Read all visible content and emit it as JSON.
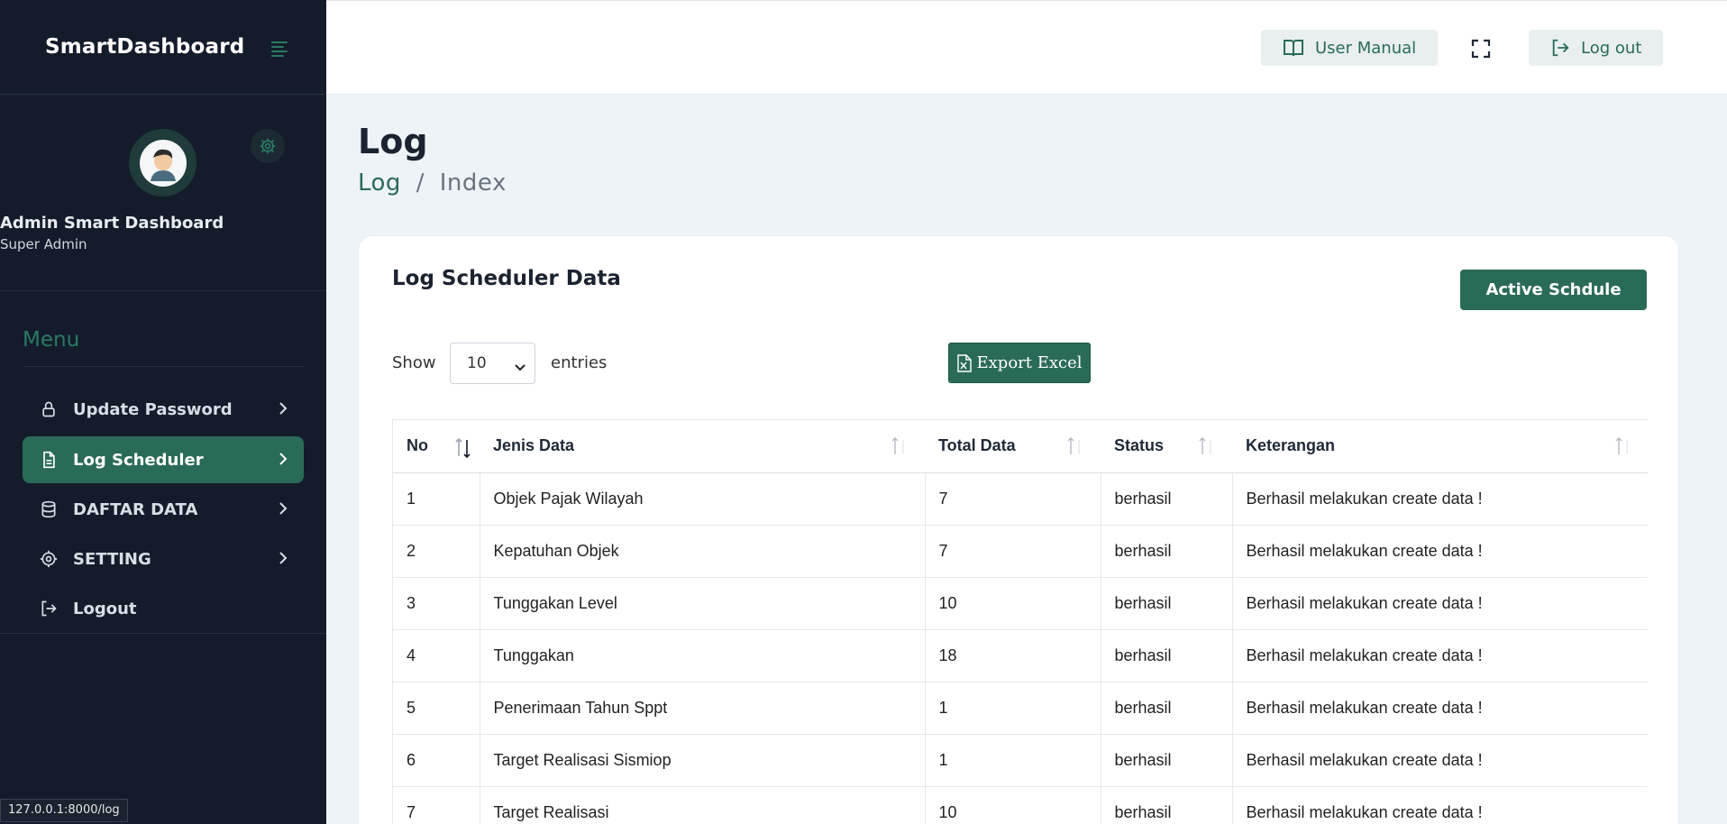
{
  "app": {
    "brand": "SmartDashboard"
  },
  "sidebar": {
    "user_name": "Admin Smart Dashboard",
    "user_role": "Super Admin",
    "menu_title": "Menu",
    "items": [
      {
        "label": "Update Password",
        "icon": "lock-icon",
        "active": false
      },
      {
        "label": "Log Scheduler",
        "icon": "document-icon",
        "active": true
      },
      {
        "label": "DAFTAR DATA",
        "icon": "database-icon",
        "active": false
      },
      {
        "label": "SETTING",
        "icon": "gear-icon",
        "active": false
      },
      {
        "label": "Logout",
        "icon": "logout-icon",
        "active": false
      }
    ]
  },
  "topbar": {
    "user_manual": "User Manual",
    "logout": "Log out"
  },
  "page": {
    "title": "Log",
    "breadcrumb_link": "Log",
    "breadcrumb_separator": "/",
    "breadcrumb_current": "Index"
  },
  "card": {
    "title": "Log Scheduler Data",
    "active_button": "Active Schdule",
    "show_label": "Show",
    "entries_value": "10",
    "entries_label": "entries",
    "export_button": "Export Excel"
  },
  "table": {
    "columns": [
      "No",
      "Jenis Data",
      "Total Data",
      "Status",
      "Keterangan"
    ],
    "rows": [
      [
        "1",
        "Objek Pajak Wilayah",
        "7",
        "berhasil",
        "Berhasil melakukan create data !"
      ],
      [
        "2",
        "Kepatuhan Objek",
        "7",
        "berhasil",
        "Berhasil melakukan create data !"
      ],
      [
        "3",
        "Tunggakan Level",
        "10",
        "berhasil",
        "Berhasil melakukan create data !"
      ],
      [
        "4",
        "Tunggakan",
        "18",
        "berhasil",
        "Berhasil melakukan create data !"
      ],
      [
        "5",
        "Penerimaan Tahun Sppt",
        "1",
        "berhasil",
        "Berhasil melakukan create data !"
      ],
      [
        "6",
        "Target Realisasi Sismiop",
        "1",
        "berhasil",
        "Berhasil melakukan create data !"
      ],
      [
        "7",
        "Target Realisasi",
        "10",
        "berhasil",
        "Berhasil melakukan create data !"
      ]
    ]
  },
  "status_bar": {
    "url": "127.0.0.1:8000/log"
  },
  "colors": {
    "accent": "#2a6b58",
    "sidebar_bg": "#141c2b",
    "page_bg": "#eef3f8"
  }
}
